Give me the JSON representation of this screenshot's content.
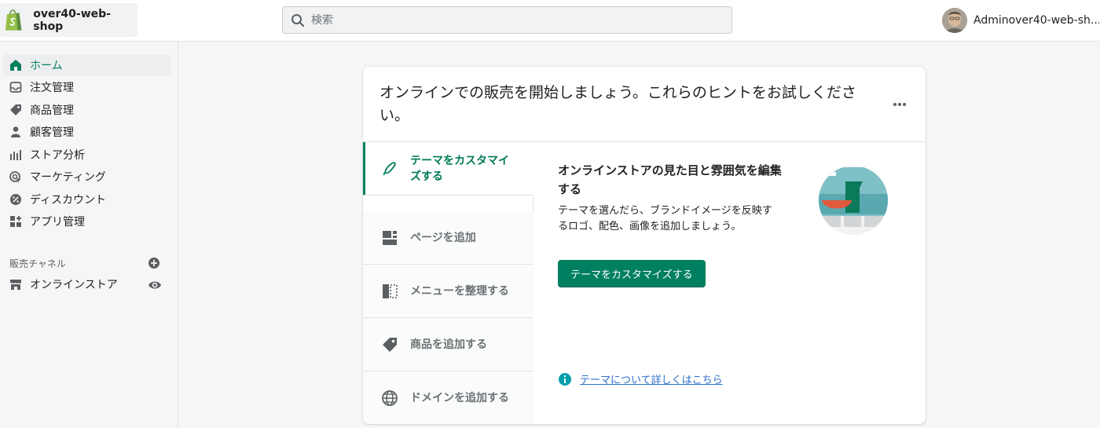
{
  "store": {
    "name": "over40-web-shop",
    "logo": "shopify-bag-icon",
    "brand_color": "#95bf47"
  },
  "search": {
    "placeholder": "検索",
    "value": ""
  },
  "user": {
    "name": "Adminover40-web-sh..."
  },
  "sidebar": {
    "items": [
      {
        "label": "ホーム",
        "icon": "home-icon",
        "active": true
      },
      {
        "label": "注文管理",
        "icon": "inbox-icon",
        "active": false
      },
      {
        "label": "商品管理",
        "icon": "tag-icon",
        "active": false
      },
      {
        "label": "顧客管理",
        "icon": "person-icon",
        "active": false
      },
      {
        "label": "ストア分析",
        "icon": "bar-chart-icon",
        "active": false
      },
      {
        "label": "マーケティング",
        "icon": "target-icon",
        "active": false
      },
      {
        "label": "ディスカウント",
        "icon": "discount-icon",
        "active": false
      },
      {
        "label": "アプリ管理",
        "icon": "apps-icon",
        "active": false
      }
    ],
    "sales_channels": {
      "label": "販売チャネル",
      "items": [
        {
          "label": "オンラインストア",
          "icon": "store-icon"
        }
      ]
    }
  },
  "card": {
    "title": "オンラインでの販売を開始しましょう。これらのヒントをお試しください。",
    "tabs": [
      {
        "label": "テーマをカスタマイズする",
        "icon": "brush-icon",
        "active": true
      },
      {
        "label": "ページを追加",
        "icon": "page-layout-icon",
        "active": false
      },
      {
        "label": "メニューを整理する",
        "icon": "menu-columns-icon",
        "active": false
      },
      {
        "label": "商品を追加する",
        "icon": "tag-icon",
        "active": false
      },
      {
        "label": "ドメインを追加する",
        "icon": "globe-icon",
        "active": false
      }
    ],
    "content": {
      "title": "オンラインストアの見た目と雰囲気を編集する",
      "description": "テーマを選んだら、ブランドイメージを反映するロゴ、配色、画像を追加しましょう。",
      "button_label": "テーマをカスタマイズする",
      "help_link": "テーマについて詳しくはこちら",
      "illustration": "theme-illustration"
    }
  },
  "colors": {
    "accent": "#008060",
    "link": "#2c6ecb",
    "info": "#00a0ac"
  }
}
